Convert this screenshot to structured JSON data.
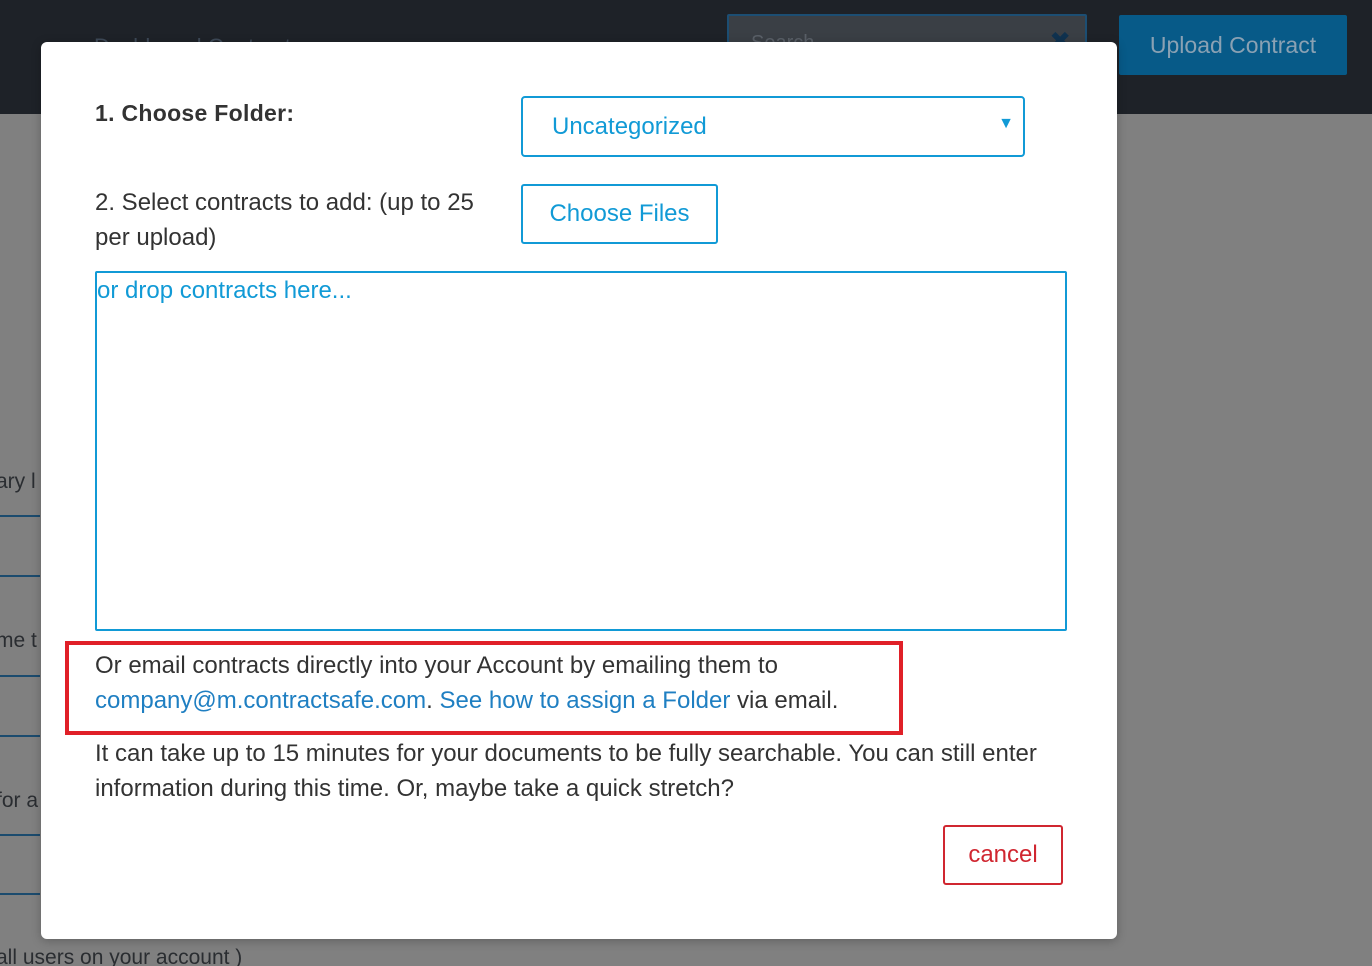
{
  "background": {
    "nav_text": "Dashboard    Contracts",
    "search_placeholder": "Search...",
    "clear_symbol": "✖",
    "upload_button": "Upload Contract",
    "labels": [
      "ary l",
      "me t",
      "for a",
      "all users on your account )"
    ]
  },
  "modal": {
    "folder_label": "1. Choose Folder:",
    "folder_value": "Uncategorized",
    "select_label": "2. Select contracts to add: (up to 25 per upload)",
    "choose_files_button": "Choose Files",
    "dropzone_hint": "or drop contracts here...",
    "email_prefix": "Or email contracts directly into your Account by emailing them to",
    "email_address": "company@m.contractsafe.com",
    "email_separator": ".",
    "assign_folder_link": "See how to assign a Folder",
    "email_suffix": "via email.",
    "info_text": "It can take up to 15 minutes for your documents to be fully searchable. You can still enter information during this time. Or, maybe take a quick stretch?",
    "cancel_button": "cancel"
  },
  "colors": {
    "accent": "#119ad6",
    "link": "#1f7fc2",
    "danger": "#d02630",
    "highlight": "#e02028"
  },
  "icons": {
    "dropdown": "caret-down-icon",
    "clear": "close-icon"
  }
}
